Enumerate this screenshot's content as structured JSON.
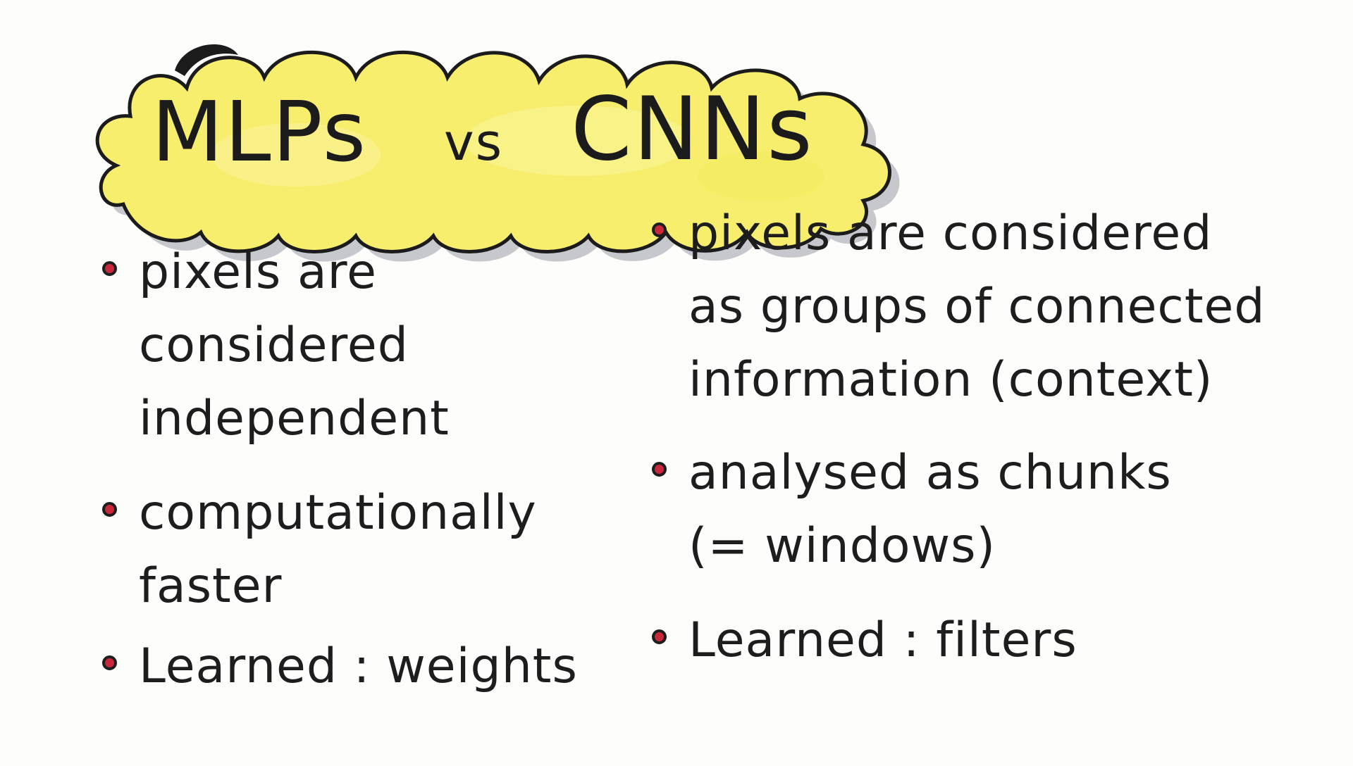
{
  "title": {
    "left": "MLPs",
    "middle": "vs",
    "right": "CNNs",
    "cloud_color": "#f7ee6e",
    "shadow_color": "#b9b9c2"
  },
  "mlps": {
    "items": [
      {
        "lines": [
          "pixels are",
          "considered",
          "independent"
        ]
      },
      {
        "lines": [
          "computationally",
          "faster"
        ]
      },
      {
        "lines": [
          "Learned : weights"
        ]
      }
    ]
  },
  "cnns": {
    "items": [
      {
        "lines": [
          "pixels are considered",
          "as groups of connected",
          "information (context)"
        ]
      },
      {
        "lines": [
          "analysed as chunks",
          "(= windows)"
        ]
      },
      {
        "lines": [
          "Learned : filters"
        ]
      }
    ]
  },
  "colors": {
    "ink": "#1d1d1d",
    "bullet_fill": "#c8283a",
    "paper": "#fdfdfc"
  }
}
